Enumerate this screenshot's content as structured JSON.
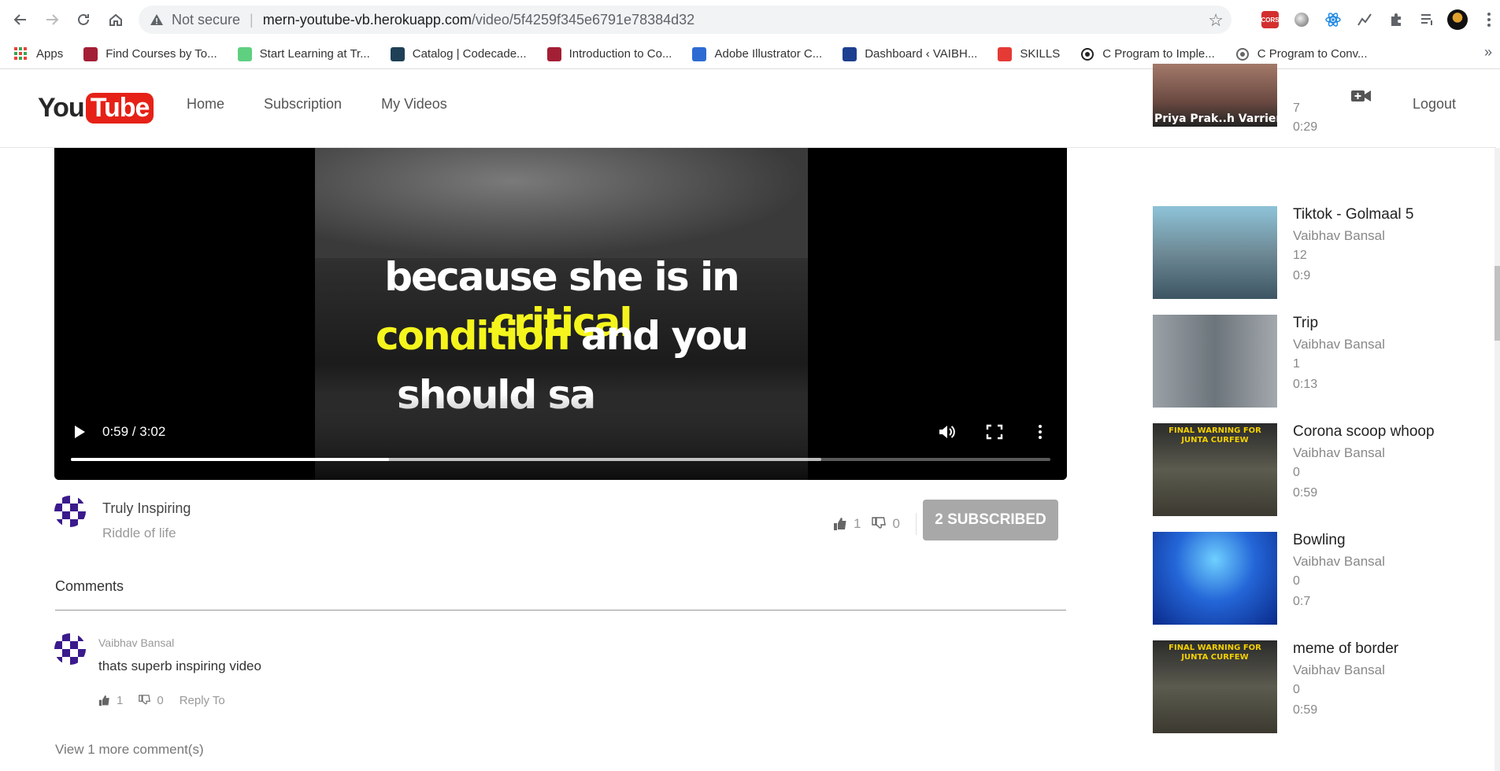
{
  "browser": {
    "security_label": "Not secure",
    "url_host": "mern-youtube-vb.herokuapp.com",
    "url_path": "/video/5f4259f345e6791e78384d32",
    "extensions": [
      "cors-icon",
      "circle-icon",
      "react-icon",
      "chart-icon",
      "puzzle-icon",
      "playlist-icon",
      "profile-avatar-icon",
      "menu-dots-icon"
    ]
  },
  "bookmarks": [
    {
      "label": "Apps",
      "icon": "apps-grid-icon",
      "color": "#4285f4"
    },
    {
      "label": "Find Courses by To...",
      "icon": "mit-icon",
      "color": "#a31f34"
    },
    {
      "label": "Start Learning at Tr...",
      "icon": "treehouse-icon",
      "color": "#5fcf80"
    },
    {
      "label": "Catalog | Codecade...",
      "icon": "codecademy-icon",
      "color": "#1f4056"
    },
    {
      "label": "Introduction to Co...",
      "icon": "mit-icon",
      "color": "#a31f34"
    },
    {
      "label": "Adobe Illustrator C...",
      "icon": "adobe-icon",
      "color": "#2d6bd3"
    },
    {
      "label": "Dashboard ‹ VAIBH...",
      "icon": "fn-icon",
      "color": "#1d3f8f"
    },
    {
      "label": "SKILLS",
      "icon": "ct-icon",
      "color": "#e53935"
    },
    {
      "label": "C Program to Imple...",
      "icon": "circle-dot-icon",
      "color": "#222"
    },
    {
      "label": "C Program to Conv...",
      "icon": "globe-icon",
      "color": "#666"
    }
  ],
  "header": {
    "logo_you": "You",
    "logo_tube": "Tube",
    "nav": [
      "Home",
      "Subscription",
      "My Videos"
    ],
    "logout": "Logout"
  },
  "video": {
    "caption_line1_a": "because she is in ",
    "caption_line1_b": "critical",
    "caption_line2_a": "condition",
    "caption_line2_b": " and you",
    "caption_line3": "should sa",
    "time": "0:59 / 3:02",
    "played_fraction": 0.325,
    "buffered_fraction": 0.766
  },
  "channel": {
    "name": "Truly Inspiring",
    "description": "Riddle of life",
    "likes": "1",
    "dislikes": "0",
    "subscribe_label": "2 SUBSCRIBED"
  },
  "comments": {
    "title": "Comments",
    "items": [
      {
        "author": "Vaibhav Bansal",
        "text": "thats superb inspiring video",
        "likes": "1",
        "dislikes": "0",
        "reply_label": "Reply To"
      }
    ],
    "view_more": "View 1 more comment(s)"
  },
  "sidebar": [
    {
      "title": "",
      "channel": "",
      "views": "7",
      "duration": "0:29",
      "thumb_text": "Priya Prak..h Varrier"
    },
    {
      "title": "Tiktok - Golmaal 5",
      "channel": "Vaibhav Bansal",
      "views": "12",
      "duration": "0:9",
      "thumb_text": ""
    },
    {
      "title": "Trip",
      "channel": "Vaibhav Bansal",
      "views": "1",
      "duration": "0:13",
      "thumb_text": ""
    },
    {
      "title": "Corona scoop whoop",
      "channel": "Vaibhav Bansal",
      "views": "0",
      "duration": "0:59",
      "thumb_text": "FINAL WARNING FOR JUNTA CURFEW"
    },
    {
      "title": "Bowling",
      "channel": "Vaibhav Bansal",
      "views": "0",
      "duration": "0:7",
      "thumb_text": ""
    },
    {
      "title": "meme of border",
      "channel": "Vaibhav Bansal",
      "views": "0",
      "duration": "0:59",
      "thumb_text": "FINAL WARNING FOR JUNTA CURFEW"
    }
  ]
}
